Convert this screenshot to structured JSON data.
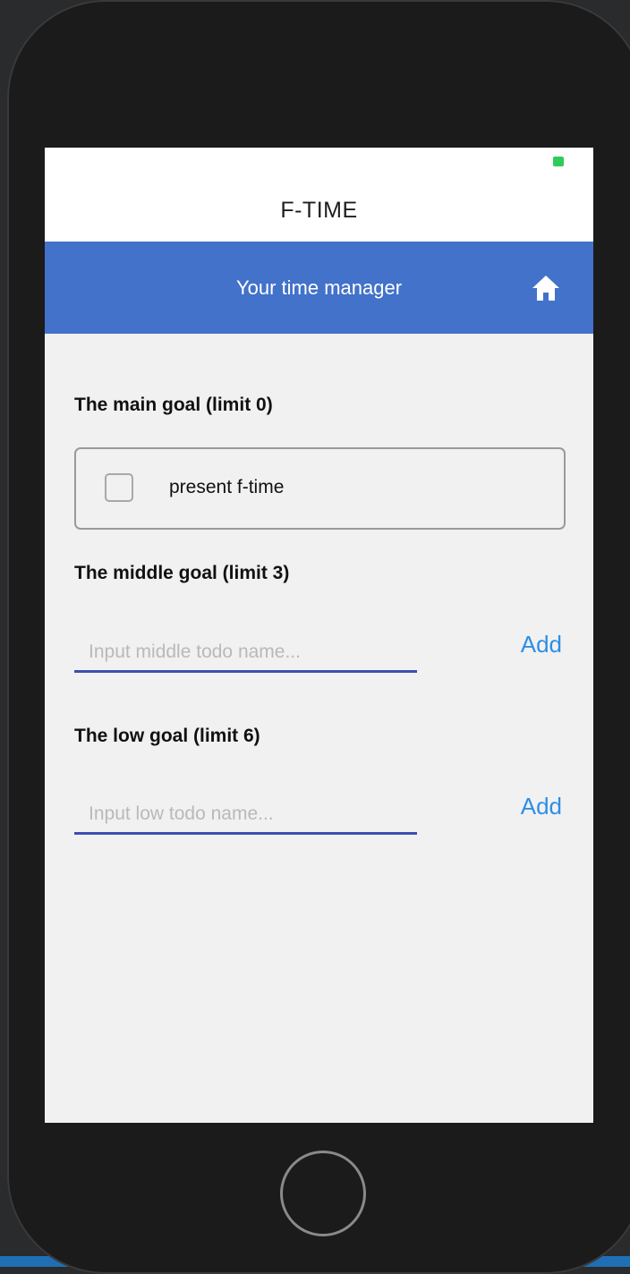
{
  "app": {
    "title": "F-TIME"
  },
  "header": {
    "subtitle": "Your time manager",
    "home_icon": "home-icon"
  },
  "main_goal": {
    "label": "The main goal (limit 0)",
    "items": [
      {
        "text": "present f-time",
        "checked": false
      }
    ]
  },
  "middle_goal": {
    "label": "The middle goal (limit 3)",
    "input_placeholder": "Input middle todo name...",
    "input_value": "",
    "add_label": "Add"
  },
  "low_goal": {
    "label": "The low goal (limit 6)",
    "input_placeholder": "Input low todo name...",
    "input_value": "",
    "add_label": "Add"
  },
  "colors": {
    "header_bg": "#4272c9",
    "input_underline": "#3c4fb0",
    "add_button": "#2d8fe6",
    "battery": "#2fcc5a"
  }
}
